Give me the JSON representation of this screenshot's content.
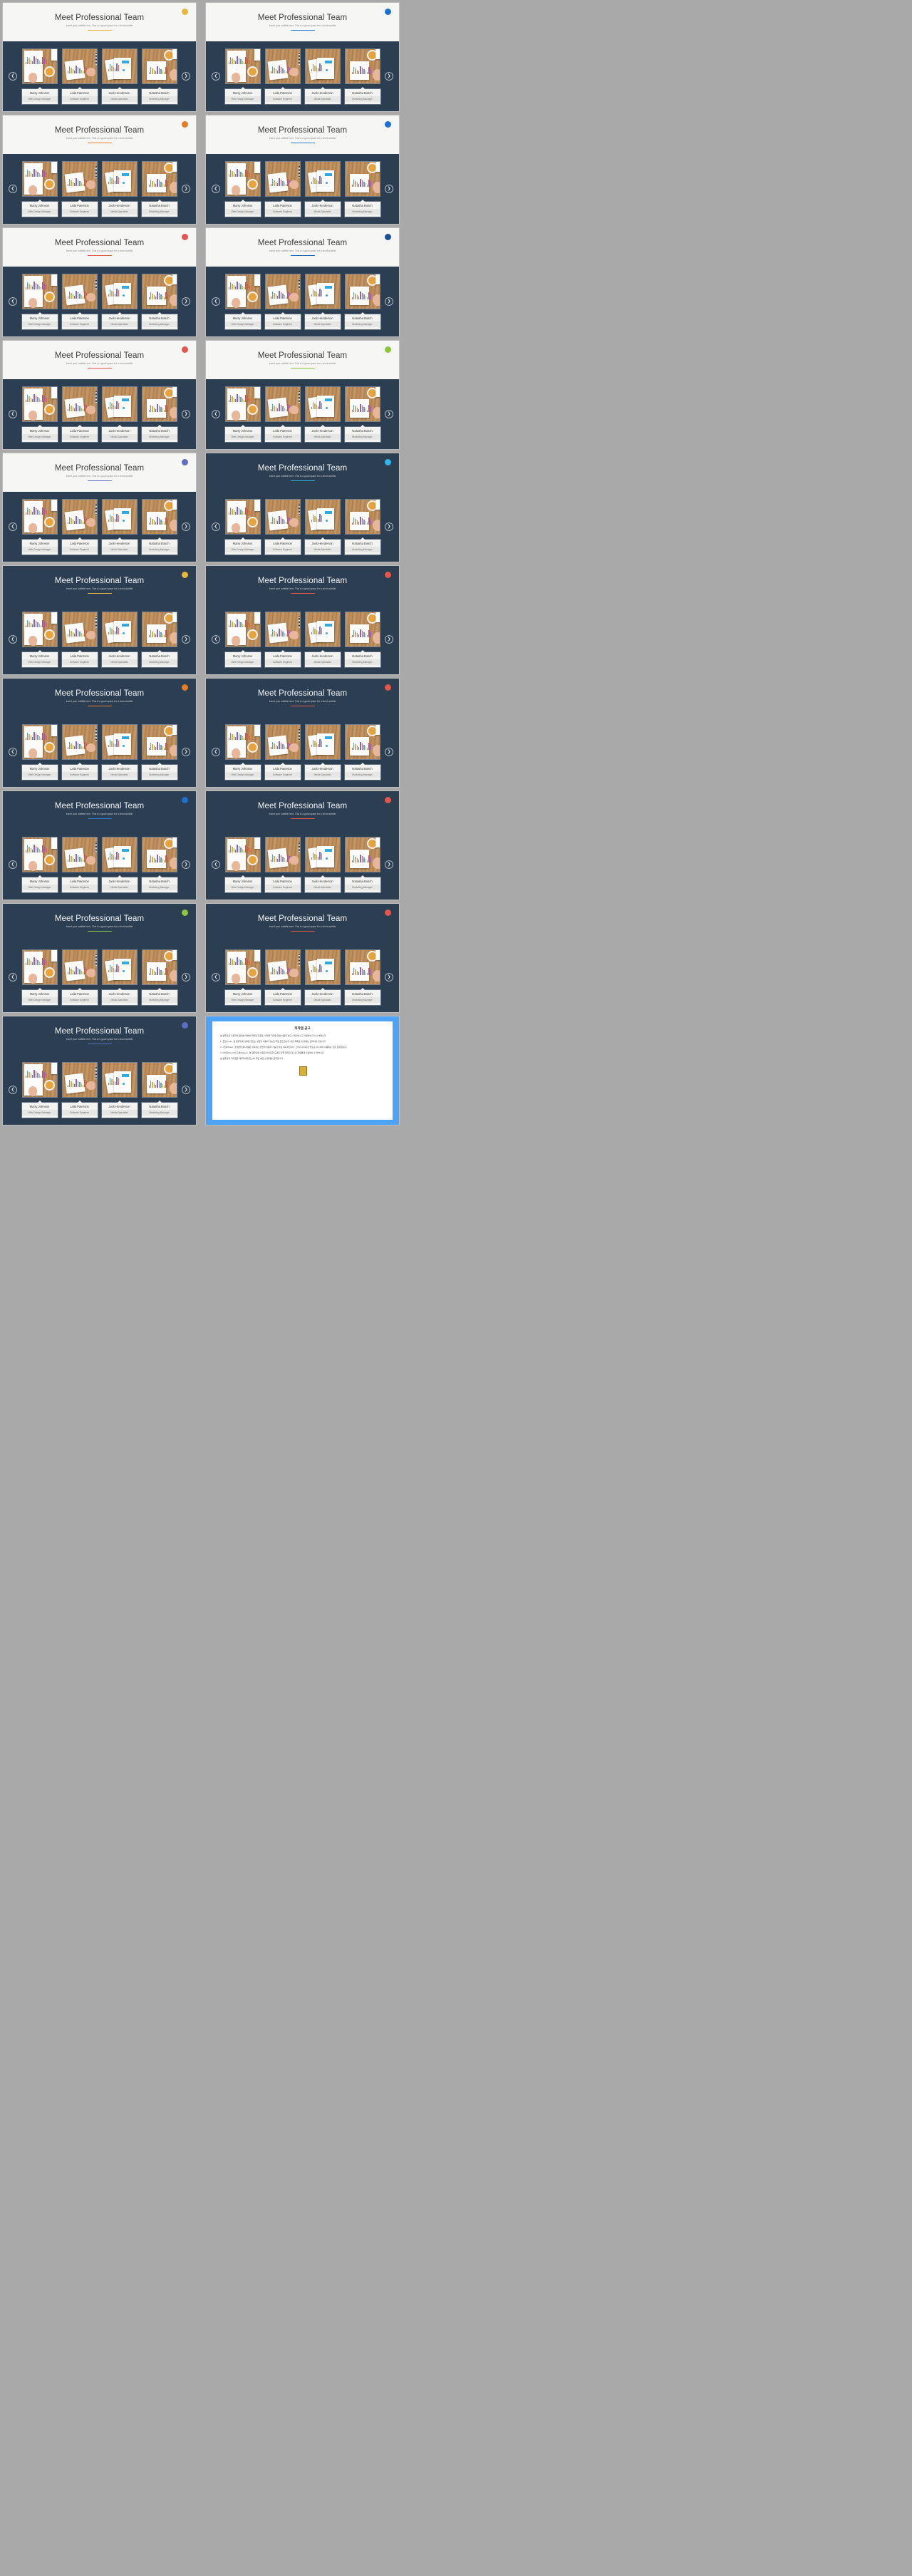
{
  "slide_common": {
    "title": "Meet Professional Team",
    "subtitle": "Insert your subtitle here. This is a good space for a short subtitle",
    "prev_arrow": "❮",
    "next_arrow": "❯",
    "members": [
      {
        "name": "Marry Johnson",
        "role": "Web Design Manager"
      },
      {
        "name": "Laila Paterson",
        "role": "Software Engineer"
      },
      {
        "name": "Jack Henderson",
        "role": "Media Specialist"
      },
      {
        "name": "Natasha Bosch",
        "role": "Marketing Manager"
      }
    ]
  },
  "slides": [
    {
      "id": 1,
      "header": "light",
      "accent": "#e8b63c",
      "badge": "#e8b63c"
    },
    {
      "id": 2,
      "header": "light",
      "accent": "#2b7fd4",
      "badge": "#1d6fd0"
    },
    {
      "id": 3,
      "header": "light",
      "accent": "#e87a22",
      "badge": "#e87a22"
    },
    {
      "id": 4,
      "header": "light",
      "accent": "#2b7fd4",
      "badge": "#1d6fd0"
    },
    {
      "id": 5,
      "header": "light",
      "accent": "#e2564b",
      "badge": "#e2564b"
    },
    {
      "id": 6,
      "header": "light",
      "accent": "#1e5fa8",
      "badge": "#1b4f96"
    },
    {
      "id": 7,
      "header": "light",
      "accent": "#e2564b",
      "badge": "#e2564b"
    },
    {
      "id": 8,
      "header": "light",
      "accent": "#8cc63f",
      "badge": "#8cc63f"
    },
    {
      "id": 9,
      "header": "light",
      "accent": "#5b6ec4",
      "badge": "#5b6ec4"
    },
    {
      "id": 10,
      "header": "dark",
      "accent": "#2fb7e8",
      "badge": "#2fb7e8"
    },
    {
      "id": 11,
      "header": "dark",
      "accent": "#e8b63c",
      "badge": "#e8b63c"
    },
    {
      "id": 12,
      "header": "dark",
      "accent": "#e2564b",
      "badge": "#e2564b"
    },
    {
      "id": 13,
      "header": "dark",
      "accent": "#e87a22",
      "badge": "#e87a22"
    },
    {
      "id": 14,
      "header": "dark",
      "accent": "#e2564b",
      "badge": "#e2564b"
    },
    {
      "id": 15,
      "header": "dark",
      "accent": "#2b7fd4",
      "badge": "#1d6fd0"
    },
    {
      "id": 16,
      "header": "dark",
      "accent": "#e2564b",
      "badge": "#e2564b"
    },
    {
      "id": 17,
      "header": "dark",
      "accent": "#8cc63f",
      "badge": "#8cc63f"
    },
    {
      "id": 18,
      "header": "dark",
      "accent": "#e2564b",
      "badge": "#e2564b"
    },
    {
      "id": 19,
      "header": "dark",
      "accent": "#5b6ec4",
      "badge": "#5b6ec4"
    }
  ],
  "document_slide": {
    "title": "저작권 공고",
    "paragraphs": [
      "본 템플릿은 사용자의 편의를 위하여 제작된 자료로, 아래의 저작권 관련 내용을 반드시 확인하시고 사용하여 주시기 바랍니다.",
      "1. 폰트(Font) : 본 템플릿에 사용된 폰트는 상업적 이용이 가능한 무료 폰트입니다. 다만 재배포 및 판매는 금지되어 있습니다.",
      "2. 사진(Photo) : 본 템플릿에 사용된 이미지는 상업적 이용이 가능한 무료 이미지입니다. 그러나 이미지만 별도로 추출하여 사용하는 것은 금지됩니다.",
      "3. 아이콘(Icon) 및 도형(Shape) : 본 템플릿에 사용된 아이콘과 도형은 직접 제작한 것으로 자유롭게 사용하실 수 있습니다.",
      "본 템플릿의 저작권은 제작자에게 있으며, 무단 배포 및 판매를 금지합니다."
    ]
  }
}
